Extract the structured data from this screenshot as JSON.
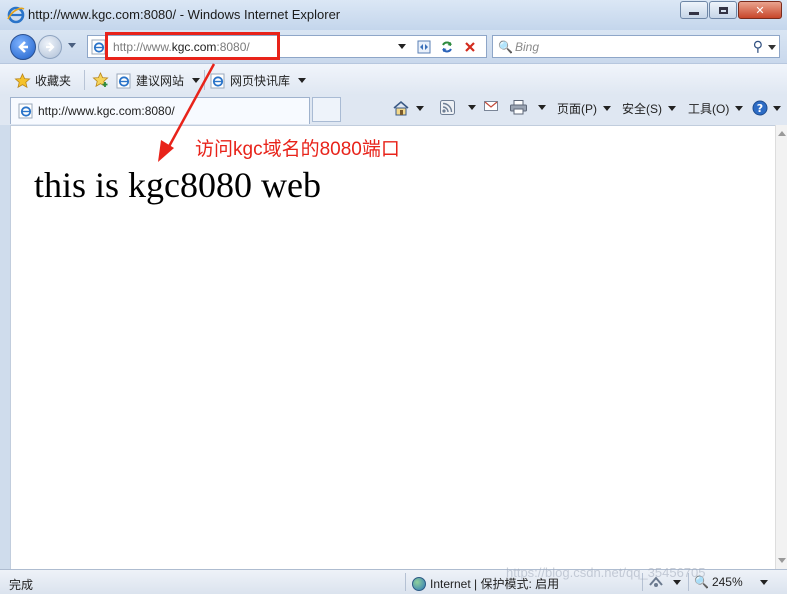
{
  "window": {
    "title": "http://www.kgc.com:8080/ - Windows Internet Explorer"
  },
  "navbar": {
    "address_prefix": "http://www.",
    "address_host": "kgc.com",
    "address_suffix": ":8080/",
    "search_placeholder": "Bing"
  },
  "favorites_bar": {
    "favorites_label": "收藏夹",
    "items": [
      {
        "label": "建议网站"
      },
      {
        "label": "网页快讯库"
      }
    ]
  },
  "tabs": {
    "active_tab_label": "http://www.kgc.com:8080/"
  },
  "command_bar": {
    "page_label": "页面(P)",
    "safety_label": "安全(S)",
    "tools_label": "工具(O)"
  },
  "content": {
    "page_text": "this is kgc8080 web"
  },
  "annotation": {
    "text": "访问kgc域名的8080端口",
    "color": "#e8231a"
  },
  "statusbar": {
    "status_text": "完成",
    "zone_text": "Internet | 保护模式: 启用",
    "zoom_text": "245%"
  },
  "watermark": {
    "text": "https://blog.csdn.net/qq_35456705"
  }
}
